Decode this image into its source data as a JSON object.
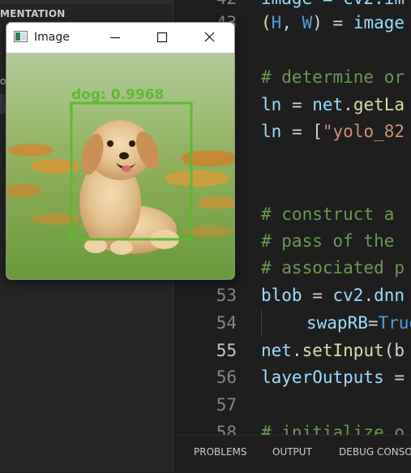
{
  "explorer": {
    "section_title": "MENTATION",
    "stray_char": "o"
  },
  "editor": {
    "line_numbers": [
      "42",
      "43",
      "",
      "",
      "",
      "",
      "",
      "",
      "",
      "",
      "53",
      "54",
      "55",
      "56",
      "57",
      "58"
    ],
    "active_line": "55"
  },
  "code": {
    "l42": "image = cv2.im",
    "l43_a": "(",
    "l43_b": "H",
    "l43_c": ", ",
    "l43_d": "W",
    "l43_e": ") = ",
    "l43_f": "image",
    "c1": "# determine or",
    "ln1_a": "ln",
    "ln1_b": " = ",
    "ln1_c": "net",
    "ln1_d": ".",
    "ln1_e": "getLa",
    "ln2_a": "ln",
    "ln2_b": " = [",
    "ln2_c": "\"yolo_82",
    "c2": "# construct a ",
    "c3": "# pass of the ",
    "c4": "# associated p",
    "b_a": "blob",
    "b_b": " = ",
    "b_c": "cv2",
    "b_d": ".",
    "b_e": "dnn",
    "s_a": "swapRB",
    "s_b": "=",
    "s_c": "True",
    "n_a": "net",
    "n_b": ".",
    "n_c": "setInput",
    "n_d": "(b",
    "lo_a": "layerOutputs",
    "lo_b": " =",
    "c5": "# initialize o"
  },
  "panel": {
    "tabs": [
      "PROBLEMS",
      "OUTPUT",
      "DEBUG CONSO"
    ]
  },
  "window": {
    "title": "Image",
    "detection": {
      "label": "dog: 0.9968",
      "class": "dog",
      "confidence": 0.9968,
      "box_color": "#5fb832"
    }
  },
  "colors": {
    "editor_bg": "#1e1e1e",
    "sidebar_bg": "#252526",
    "comment": "#6a9955",
    "variable": "#9cdcfe",
    "function": "#dcdcaa",
    "string": "#ce9178"
  }
}
